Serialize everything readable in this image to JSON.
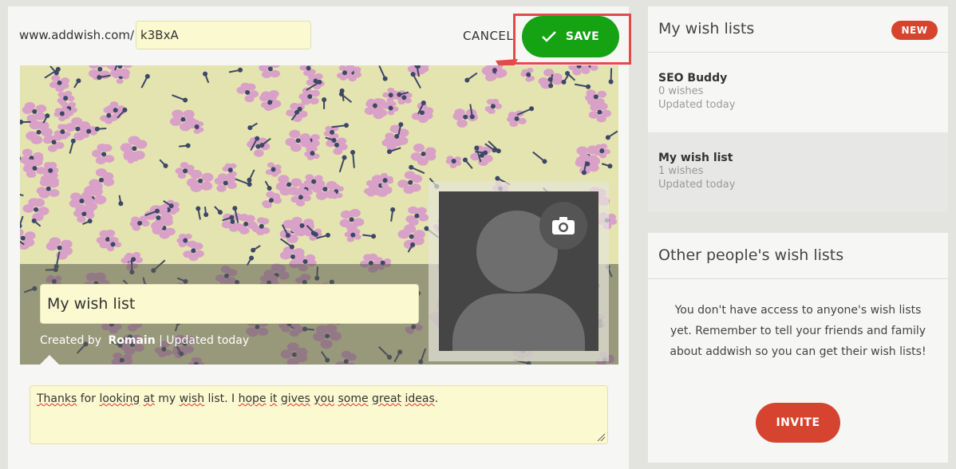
{
  "header": {
    "url_prefix": "www.addwish.com/",
    "url_slug": "k3BxA",
    "cancel_label": "CANCEL",
    "save_label": "SAVE"
  },
  "wishlist": {
    "title": "My wish list",
    "created_by_label": "Created by",
    "author": "Romain",
    "updated": "| Updated today",
    "description_words": [
      "Thanks",
      " for ",
      "looking",
      " ",
      "at",
      " my ",
      "wish",
      " list. I ",
      "hope",
      " ",
      "it",
      " ",
      "gives",
      " ",
      "you",
      " ",
      "some",
      " ",
      "great",
      " ",
      "ideas",
      "."
    ]
  },
  "sidebar": {
    "my_lists_title": "My wish lists",
    "new_badge": "NEW",
    "items": [
      {
        "name": "SEO Buddy",
        "count": "0 wishes",
        "updated": "Updated today"
      },
      {
        "name": "My wish list",
        "count": "1 wishes",
        "updated": "Updated today"
      }
    ],
    "others_title": "Other people's wish lists",
    "others_text": "You don't have access to anyone's wish lists yet. Remember to tell your friends and family about addwish so you can get their wish lists!",
    "invite_label": "INVITE"
  },
  "colors": {
    "save_green": "#15a313",
    "accent_red": "#d6442f",
    "highlight_red": "#e34b48",
    "input_yellow": "#fbf9cf"
  }
}
